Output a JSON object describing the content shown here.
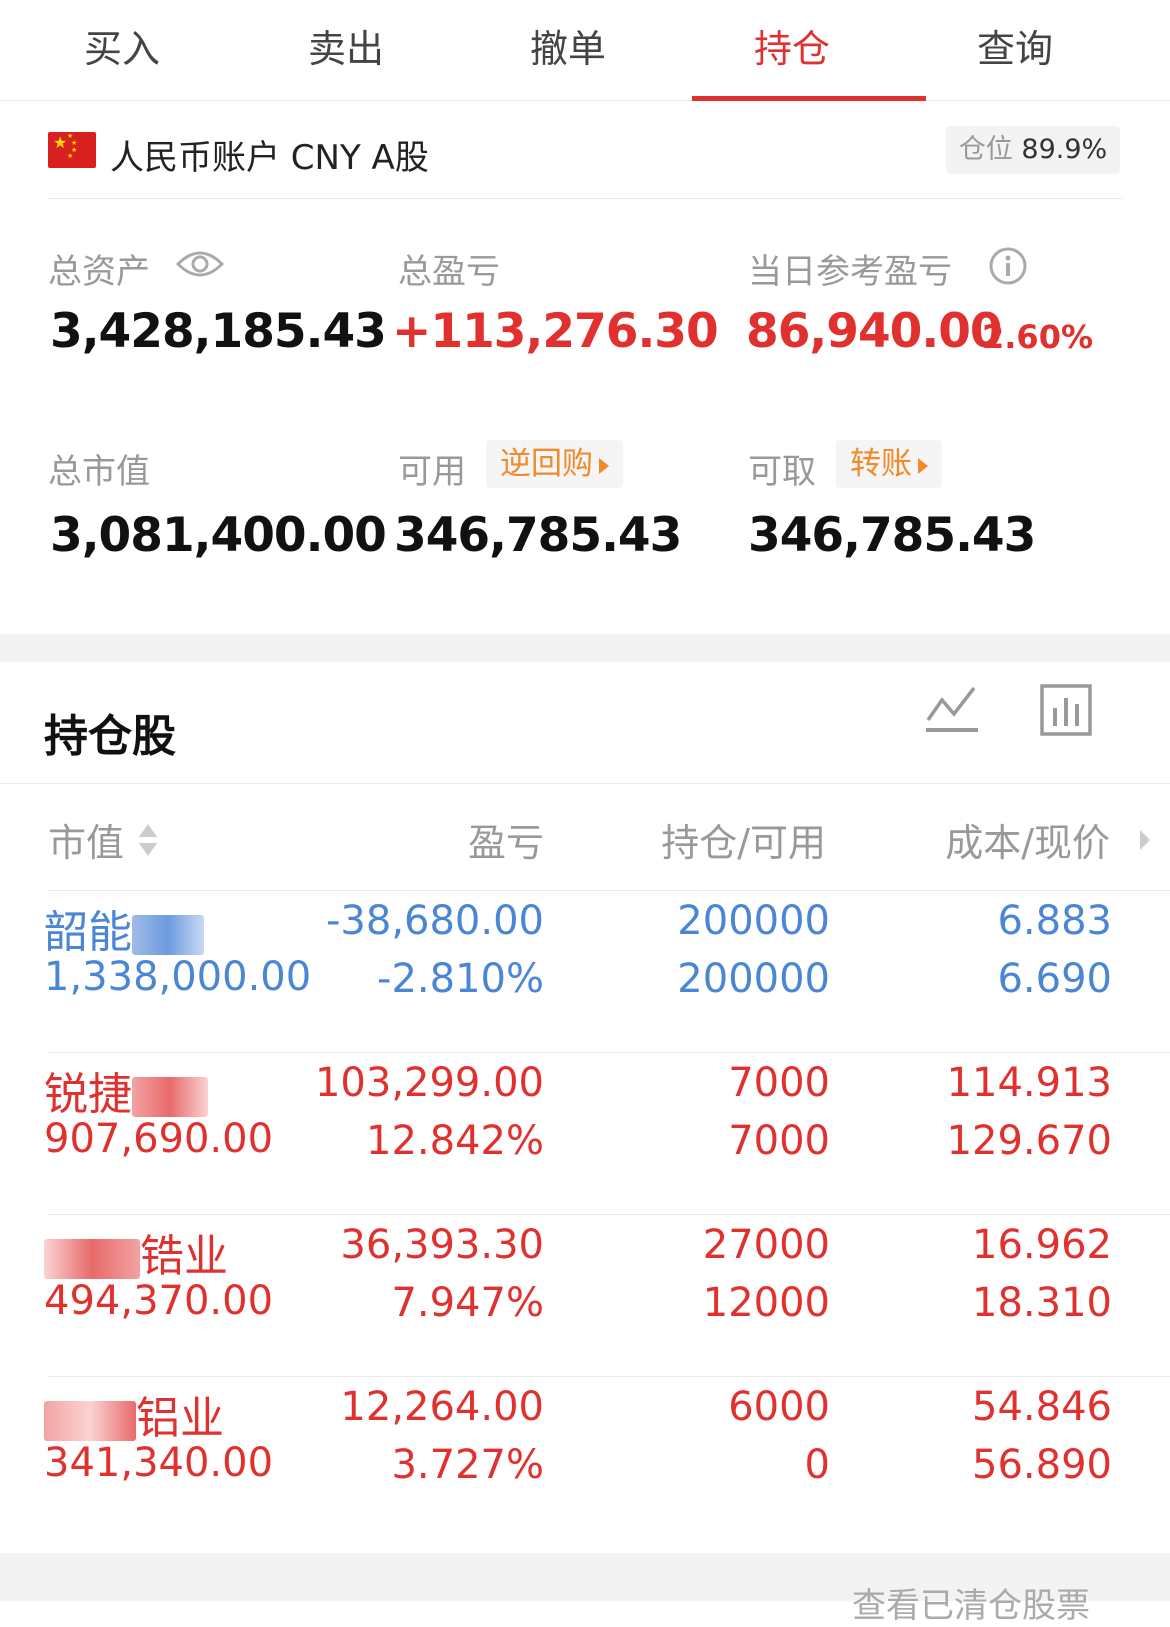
{
  "tabs": [
    "买入",
    "卖出",
    "撤单",
    "持仓",
    "查询"
  ],
  "active_tab": "持仓",
  "account": {
    "name": "人民币账户 CNY A股",
    "position_label": "仓位",
    "position_value": "89.9%"
  },
  "summary": {
    "total_assets_label": "总资产",
    "total_assets": "3,428,185.43",
    "total_pnl_label": "总盈亏",
    "total_pnl": "+113,276.30",
    "daily_pnl_label": "当日参考盈亏",
    "daily_pnl": "86,940.00",
    "daily_pnl_pct": "2.60%",
    "market_value_label": "总市值",
    "market_value": "3,081,400.00",
    "available_label": "可用",
    "available_btn": "逆回购",
    "available": "346,785.43",
    "withdrawable_label": "可取",
    "withdrawable_btn": "转账",
    "withdrawable": "346,785.43"
  },
  "holdings": {
    "title": "持仓股",
    "columns": {
      "market_value": "市值",
      "pnl": "盈亏",
      "position": "持仓/可用",
      "cost_price": "成本/现价"
    },
    "rows": [
      {
        "name": "韶能",
        "market_value": "1,338,000.00",
        "pnl": "-38,680.00",
        "pnl_pct": "-2.810%",
        "position": "200000",
        "available": "200000",
        "cost": "6.883",
        "price": "6.690",
        "color": "#4a86d4"
      },
      {
        "name": "锐捷",
        "market_value": "907,690.00",
        "pnl": "103,299.00",
        "pnl_pct": "12.842%",
        "position": "7000",
        "available": "7000",
        "cost": "114.913",
        "price": "129.670",
        "color": "#e0312f"
      },
      {
        "name": "锆业",
        "market_value": "494,370.00",
        "pnl": "36,393.30",
        "pnl_pct": "7.947%",
        "position": "27000",
        "available": "12000",
        "cost": "16.962",
        "price": "18.310",
        "color": "#e0312f"
      },
      {
        "name": "铝业",
        "market_value": "341,340.00",
        "pnl": "12,264.00",
        "pnl_pct": "3.727%",
        "position": "6000",
        "available": "0",
        "cost": "54.846",
        "price": "56.890",
        "color": "#e0312f"
      }
    ]
  },
  "footer_link": "查看已清仓股票"
}
